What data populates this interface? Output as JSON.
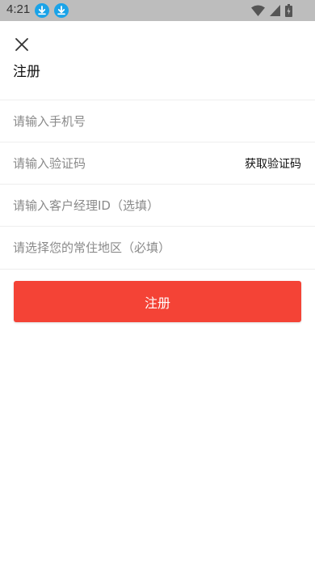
{
  "status_bar": {
    "time": "4:21",
    "icons": [
      "download-icon",
      "download-icon",
      "wifi-icon",
      "signal-icon",
      "battery-icon"
    ],
    "download_icon_color": "#1aa3e8",
    "background": "#bdbdbd"
  },
  "header": {
    "close_icon": "close-icon",
    "title": "注册"
  },
  "form": {
    "phone_placeholder": "请输入手机号",
    "code_placeholder": "请输入验证码",
    "get_code_label": "获取验证码",
    "manager_id_placeholder": "请输入客户经理ID（选填）",
    "region_placeholder": "请选择您的常住地区（必填）"
  },
  "submit": {
    "label": "注册",
    "color": "#f44336"
  }
}
